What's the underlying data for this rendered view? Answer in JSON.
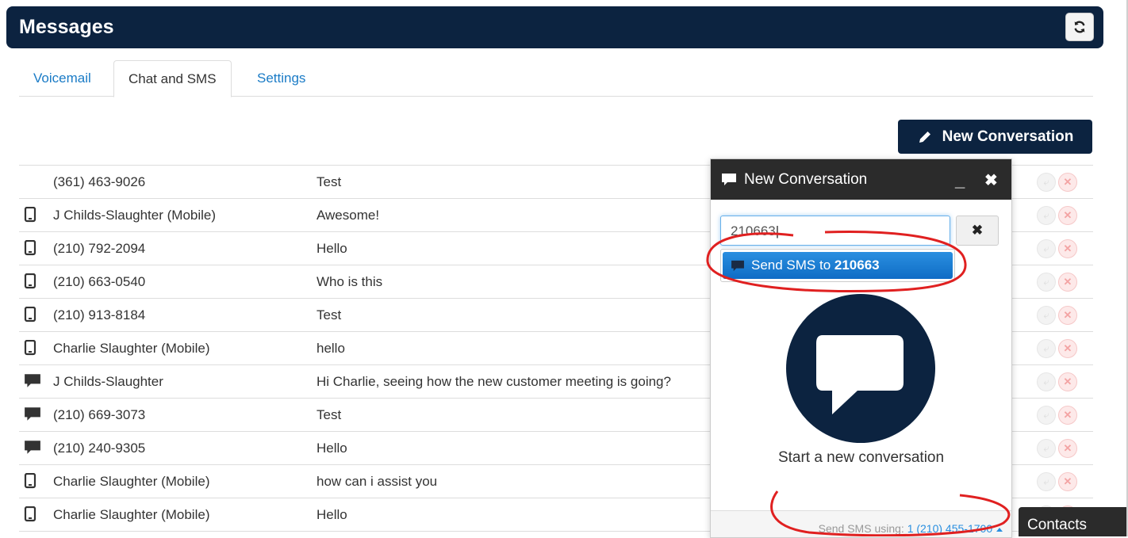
{
  "header": {
    "title": "Messages",
    "refresh_icon": "refresh-icon"
  },
  "tabs": [
    {
      "label": "Voicemail",
      "active": false
    },
    {
      "label": "Chat and SMS",
      "active": true
    },
    {
      "label": "Settings",
      "active": false
    }
  ],
  "new_conversation_button": {
    "label": "New Conversation",
    "icon": "pencil-icon"
  },
  "rows": [
    {
      "icon": "",
      "name": "(361) 463-9026",
      "message": "Test"
    },
    {
      "icon": "mobile-icon",
      "name": "J Childs-Slaughter (Mobile)",
      "message": "Awesome!"
    },
    {
      "icon": "mobile-icon",
      "name": "(210) 792-2094",
      "message": "Hello"
    },
    {
      "icon": "mobile-icon",
      "name": "(210) 663-0540",
      "message": "Who is this"
    },
    {
      "icon": "mobile-icon",
      "name": "(210) 913-8184",
      "message": "Test"
    },
    {
      "icon": "mobile-icon",
      "name": "Charlie Slaughter (Mobile)",
      "message": "hello"
    },
    {
      "icon": "chat-icon",
      "name": "J Childs-Slaughter",
      "message": "Hi Charlie, seeing how the new customer meeting is going?"
    },
    {
      "icon": "chat-icon",
      "name": "(210) 669-3073",
      "message": "Test"
    },
    {
      "icon": "chat-icon",
      "name": "(210) 240-9305",
      "message": "Hello"
    },
    {
      "icon": "mobile-icon",
      "name": "Charlie Slaughter (Mobile)",
      "message": "how can i assist you"
    },
    {
      "icon": "mobile-icon",
      "name": "Charlie Slaughter (Mobile)",
      "message": "Hello"
    }
  ],
  "popup": {
    "title": "New Conversation",
    "search_value": "210663",
    "clear_icon": "close-icon",
    "suggestion_prefix": "Send SMS to ",
    "suggestion_number": "210663",
    "empty_state": "Start a new conversation",
    "footer_label": "Send SMS using: ",
    "footer_number": "1 (210) 455-1700",
    "minimize_label": "_",
    "close_label": "✖"
  },
  "contacts_tab": {
    "label": "Contacts"
  },
  "colors": {
    "navy": "#0c2340",
    "link": "#1a7bc6",
    "annotation": "#e02020"
  }
}
